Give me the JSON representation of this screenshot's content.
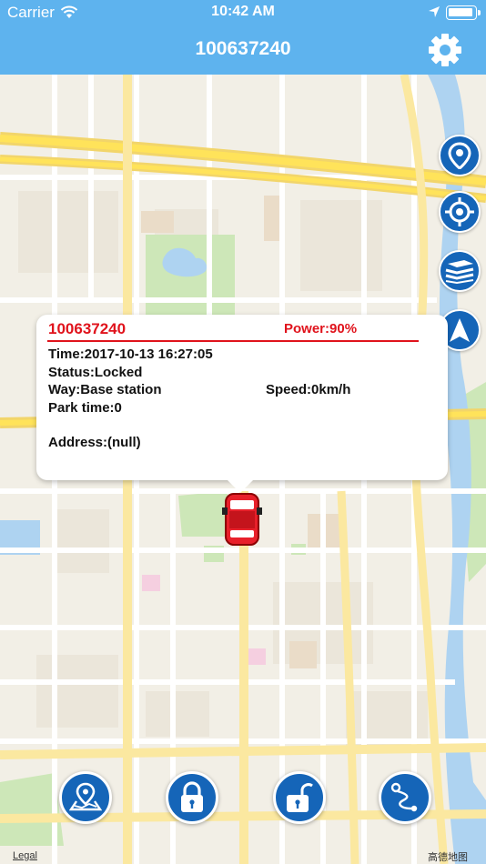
{
  "status_bar": {
    "carrier": "Carrier",
    "time": "10:42 AM"
  },
  "nav": {
    "title": "100637240",
    "settings_icon": "gear-icon"
  },
  "side_buttons": [
    {
      "name": "location-pin-icon"
    },
    {
      "name": "crosshair-icon"
    },
    {
      "name": "layers-icon"
    },
    {
      "name": "navigation-arrow-icon"
    }
  ],
  "popup": {
    "device_id": "100637240",
    "power": "Power:90%",
    "time": "Time:2017-10-13 16:27:05",
    "status": "Status:Locked",
    "way": "Way:Base station",
    "speed": "Speed:0km/h",
    "park_time": "Park time:0",
    "address": "Address:(null)"
  },
  "bottom_buttons": [
    {
      "name": "map-location-icon"
    },
    {
      "name": "lock-icon"
    },
    {
      "name": "unlock-icon"
    },
    {
      "name": "route-icon"
    }
  ],
  "map_footer": {
    "legal": "Legal",
    "provider": "高德地图"
  },
  "colors": {
    "header": "#5eb3ee",
    "accent": "#1565b8",
    "alert": "#e0131c",
    "car": "#e8202a"
  }
}
